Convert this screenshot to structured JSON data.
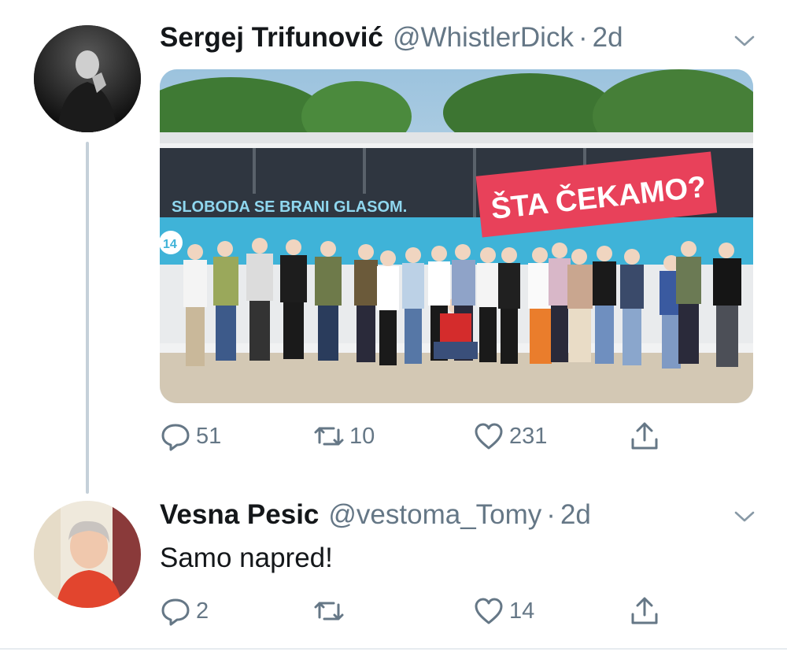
{
  "tweets": [
    {
      "display_name": "Sergej Trifunović",
      "handle": "@WhistlerDick",
      "separator": "·",
      "time": "2d",
      "image": {
        "banner_slogan": "SLOBODA SE BRANI GLASOM.",
        "banner_sign": "ŠTA ČEKAMO?",
        "list_number": "14"
      },
      "replies": "51",
      "retweets": "10",
      "likes": "231"
    },
    {
      "display_name": "Vesna Pesic",
      "handle": "@vestoma_Tomy",
      "separator": "·",
      "time": "2d",
      "text": "Samo napred!",
      "replies": "2",
      "retweets": "",
      "likes": "14"
    }
  ],
  "colors": {
    "text_primary": "#14171a",
    "text_secondary": "#657786",
    "thread_line": "#c5d0d9",
    "banner_red": "#e8415a",
    "banner_blue": "#3fb3d8"
  },
  "icons": [
    "reply-icon",
    "retweet-icon",
    "like-icon",
    "share-icon",
    "chevron-down-icon"
  ]
}
